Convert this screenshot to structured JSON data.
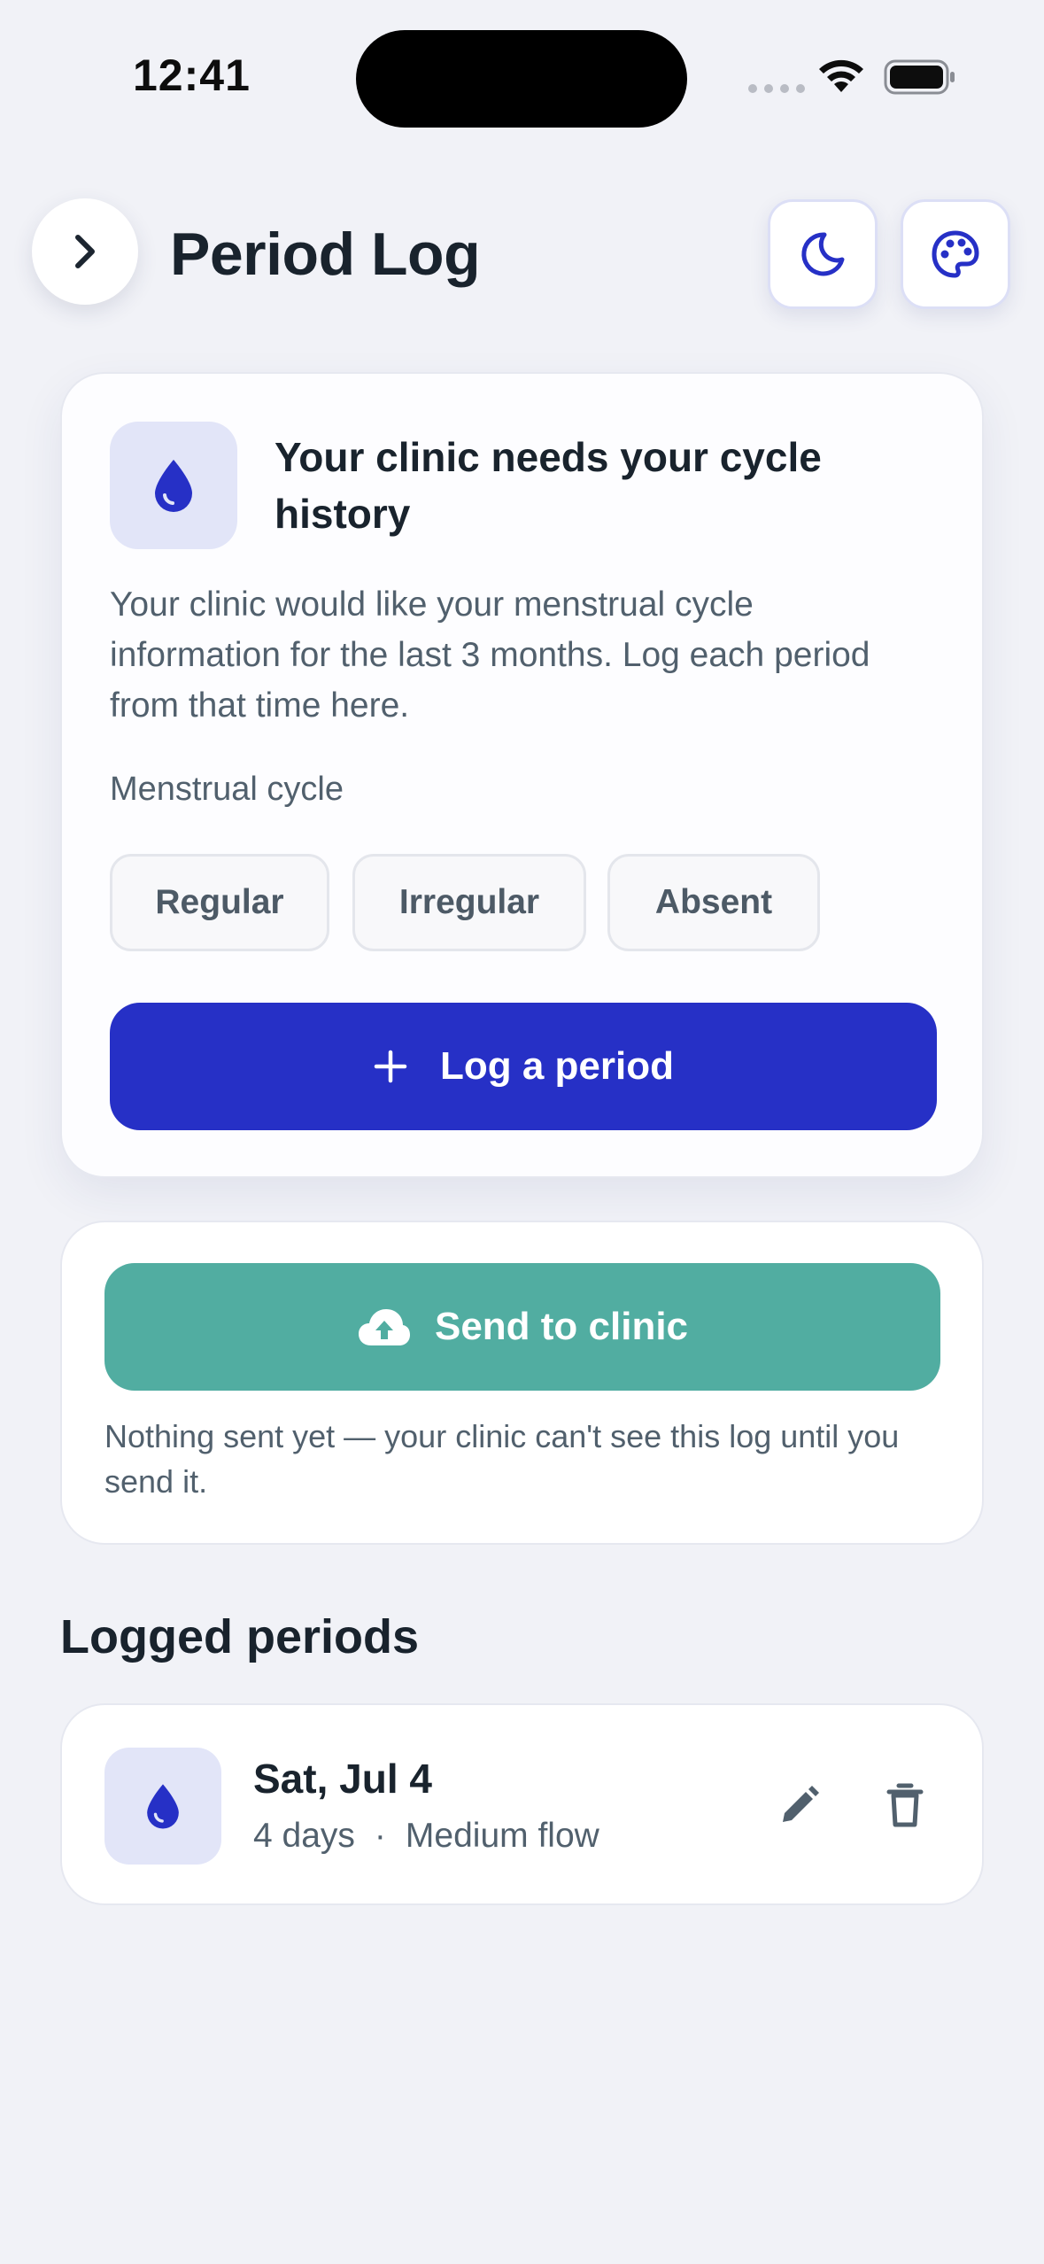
{
  "status_bar": {
    "time": "12:41"
  },
  "header": {
    "title": "Period Log"
  },
  "request_card": {
    "title": "Your clinic needs your cycle history",
    "description": "Your clinic would like your menstrual cycle information for the last 3 months. Log each period from that time here.",
    "cycle_label": "Menstrual cycle",
    "cycle_options": [
      "Regular",
      "Irregular",
      "Absent"
    ],
    "log_button": "Log a period"
  },
  "send_card": {
    "button": "Send to clinic",
    "note": "Nothing sent yet — your clinic can't see this log until you send it."
  },
  "logged_periods": {
    "title": "Logged periods",
    "entries": [
      {
        "date": "Sat, Jul 4",
        "duration": "4 days",
        "separator": "·",
        "flow": "Medium flow"
      }
    ]
  },
  "colors": {
    "accent": "#2630c6",
    "send": "#51ada1",
    "background": "#f1f2f7",
    "icon_tile": "#e2e5f8"
  },
  "icons": {
    "back": "chevron-right-icon",
    "theme": "moon-icon",
    "palette": "palette-icon",
    "drop": "drop-icon",
    "add": "plus-icon",
    "upload": "cloud-upload-icon",
    "edit": "pencil-icon",
    "delete": "trash-icon"
  }
}
